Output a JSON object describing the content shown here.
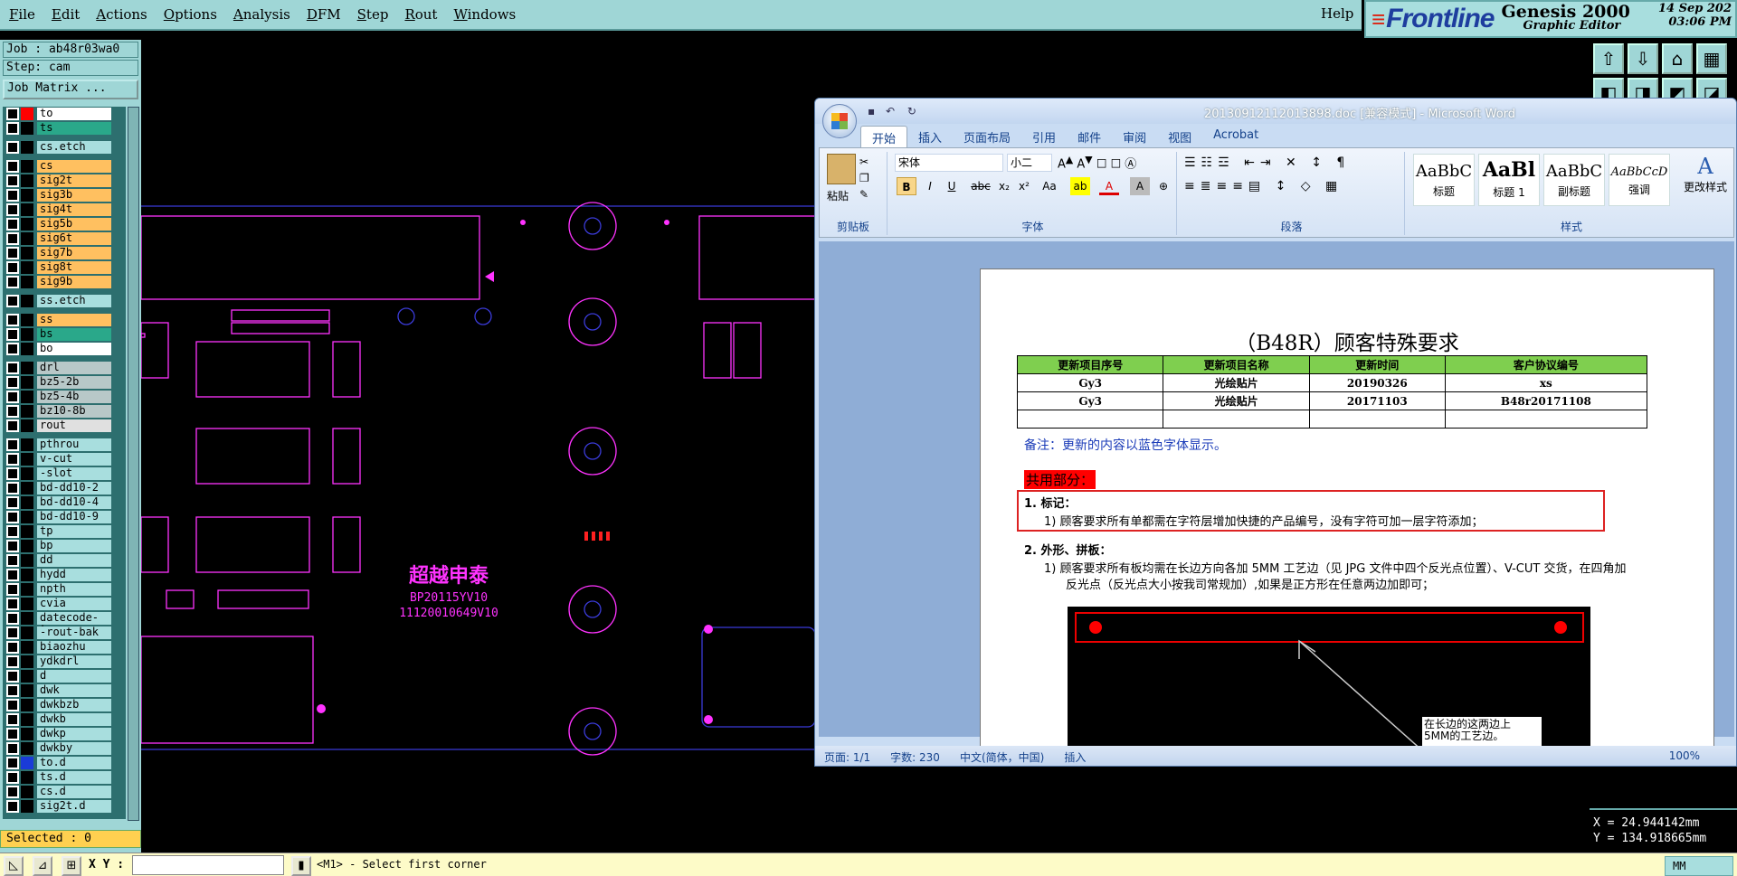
{
  "app": {
    "menu": [
      "File",
      "Edit",
      "Actions",
      "Options",
      "Analysis",
      "DFM",
      "Step",
      "Rout",
      "Windows"
    ],
    "help": "Help",
    "brand": {
      "logo": "Frontline",
      "product": "Genesis 2000",
      "subtitle": "Graphic Editor",
      "date": "14  Sep 202",
      "time": "03:06 PM"
    }
  },
  "left_panel": {
    "job": "Job : ab48r03wa0",
    "step": "Step: cam",
    "job_matrix": "Job Matrix ...",
    "layers": [
      {
        "name": "to",
        "color": "#ffffff",
        "swatch": "#ff0000"
      },
      {
        "name": "ts",
        "color": "#2aa88a",
        "swatch": "#000000"
      },
      {
        "gap": true
      },
      {
        "name": "cs.etch",
        "color": "#a8dede",
        "swatch": "#000000"
      },
      {
        "gap": true
      },
      {
        "name": "cs",
        "color": "#ffc060",
        "swatch": "#000000"
      },
      {
        "name": "sig2t",
        "color": "#ffc060",
        "swatch": "#000000"
      },
      {
        "name": "sig3b",
        "color": "#ffc060",
        "swatch": "#000000"
      },
      {
        "name": "sig4t",
        "color": "#ffc060",
        "swatch": "#000000"
      },
      {
        "name": "sig5b",
        "color": "#ffc060",
        "swatch": "#000000"
      },
      {
        "name": "sig6t",
        "color": "#ffc060",
        "swatch": "#000000"
      },
      {
        "name": "sig7b",
        "color": "#ffc060",
        "swatch": "#000000"
      },
      {
        "name": "sig8t",
        "color": "#ffc060",
        "swatch": "#000000"
      },
      {
        "name": "sig9b",
        "color": "#ffc060",
        "swatch": "#000000"
      },
      {
        "gap": true
      },
      {
        "name": "ss.etch",
        "color": "#a8dede",
        "swatch": "#000000"
      },
      {
        "gap": true
      },
      {
        "name": "ss",
        "color": "#ffc060",
        "swatch": "#000000"
      },
      {
        "name": "bs",
        "color": "#2aa88a",
        "swatch": "#000000"
      },
      {
        "name": "bo",
        "color": "#ffffff",
        "swatch": "#000000"
      },
      {
        "gap": true
      },
      {
        "name": "drl",
        "color": "#b8c8c8",
        "swatch": "#000000"
      },
      {
        "name": "bz5-2b",
        "color": "#b8c8c8",
        "swatch": "#000000"
      },
      {
        "name": "bz5-4b",
        "color": "#b8c8c8",
        "swatch": "#000000"
      },
      {
        "name": "bz10-8b",
        "color": "#b8c8c8",
        "swatch": "#000000"
      },
      {
        "name": "rout",
        "color": "#e0e0e0",
        "swatch": "#000000"
      },
      {
        "gap": true
      },
      {
        "name": "pthrou",
        "color": "#a8dede",
        "swatch": "#000000"
      },
      {
        "name": "v-cut",
        "color": "#a8dede",
        "swatch": "#000000"
      },
      {
        "name": "-slot",
        "color": "#a8dede",
        "swatch": "#000000"
      },
      {
        "name": "bd-dd10-2",
        "color": "#a8dede",
        "swatch": "#000000"
      },
      {
        "name": "bd-dd10-4",
        "color": "#a8dede",
        "swatch": "#000000"
      },
      {
        "name": "bd-dd10-9",
        "color": "#a8dede",
        "swatch": "#000000"
      },
      {
        "name": "tp",
        "color": "#a8dede",
        "swatch": "#000000"
      },
      {
        "name": "bp",
        "color": "#a8dede",
        "swatch": "#000000"
      },
      {
        "name": "dd",
        "color": "#a8dede",
        "swatch": "#000000"
      },
      {
        "name": "hydd",
        "color": "#a8dede",
        "swatch": "#000000"
      },
      {
        "name": "npth",
        "color": "#a8dede",
        "swatch": "#000000"
      },
      {
        "name": "cvia",
        "color": "#a8dede",
        "swatch": "#000000"
      },
      {
        "name": "datecode-to",
        "color": "#a8dede",
        "swatch": "#000000"
      },
      {
        "name": "-rout-bak",
        "color": "#a8dede",
        "swatch": "#000000"
      },
      {
        "name": "biaozhu",
        "color": "#a8dede",
        "swatch": "#000000"
      },
      {
        "name": "ydkdrl",
        "color": "#a8dede",
        "swatch": "#000000"
      },
      {
        "name": "d",
        "color": "#a8dede",
        "swatch": "#000000"
      },
      {
        "name": "dwk",
        "color": "#a8dede",
        "swatch": "#000000"
      },
      {
        "name": "dwkbzb",
        "color": "#a8dede",
        "swatch": "#000000"
      },
      {
        "name": "dwkb",
        "color": "#a8dede",
        "swatch": "#000000"
      },
      {
        "name": "dwkp",
        "color": "#a8dede",
        "swatch": "#000000"
      },
      {
        "name": "dwkby",
        "color": "#a8dede",
        "swatch": "#000000"
      },
      {
        "name": "to.d",
        "color": "#a8dede",
        "swatch": "#1a3bd8"
      },
      {
        "name": "ts.d",
        "color": "#a8dede",
        "swatch": "#000000"
      },
      {
        "name": "cs.d",
        "color": "#a8dede",
        "swatch": "#000000"
      },
      {
        "name": "sig2t.d",
        "color": "#a8dede",
        "swatch": "#000000"
      }
    ],
    "selected": "Selected : 0"
  },
  "canvas": {
    "board_text_1": "超越申泰",
    "board_text_2": "BP20115YV10",
    "board_text_3": "11120010649V10"
  },
  "bottom": {
    "xy_label": "X Y :",
    "prompt": "<M1> - Select first corner",
    "units": "MM"
  },
  "coords": {
    "x": "X = 24.944142mm",
    "y": "Y = 134.918665mm"
  },
  "word": {
    "title": "20130912112013898.doc [兼容模式] - Microsoft Word",
    "tabs": [
      "开始",
      "插入",
      "页面布局",
      "引用",
      "邮件",
      "审阅",
      "视图",
      "Acrobat"
    ],
    "ribbon": {
      "clipboard": {
        "paste": "粘贴",
        "label": "剪贴板"
      },
      "font": {
        "name": "宋体",
        "size": "小二",
        "label": "字体"
      },
      "paragraph": {
        "label": "段落"
      },
      "styles": {
        "label": "样式",
        "items": [
          {
            "preview": "AaBbC",
            "name": "标题"
          },
          {
            "preview": "AaBl",
            "name": "标题 1"
          },
          {
            "preview": "AaBbC",
            "name": "副标题"
          },
          {
            "preview": "AaBbCcD",
            "name": "强调"
          }
        ],
        "change": "更改样式"
      }
    },
    "doc": {
      "title": "（B48R）顾客特殊要求",
      "table": {
        "headers": [
          "更新项目序号",
          "更新项目名称",
          "更新时间",
          "客户协议编号"
        ],
        "rows": [
          [
            "Gy3",
            "光绘贴片",
            "20190326",
            "xs"
          ],
          [
            "Gy3",
            "光绘贴片",
            "20171103",
            "B48r20171108"
          ],
          [
            "",
            "",
            "",
            ""
          ]
        ]
      },
      "note": "备注：更新的内容以蓝色字体显示。",
      "shared": "共用部分：",
      "s1": "1.   标记：",
      "s1_1": "1)  顾客要求所有单都需在字符层增加快捷的产品编号，没有字符可加一层字符添加；",
      "s2": "2.   外形、拼板：",
      "s2_1a": "1)  顾客要求所有板均需在长边方向各加 5MM 工艺边（见 JPG 文件中四个反光点位置）、V-CUT 交货，在四角加",
      "s2_1b": "反光点（反光点大小按我司常规加）,如果是正方形在任意两边加即可；",
      "img_note": "在长边的这两边上 5MM的工艺边。"
    },
    "status": {
      "page": "页面: 1/1",
      "words": "字数: 230",
      "lang": "中文(简体，中国)",
      "mode": "插入",
      "zoom": "100%"
    }
  }
}
